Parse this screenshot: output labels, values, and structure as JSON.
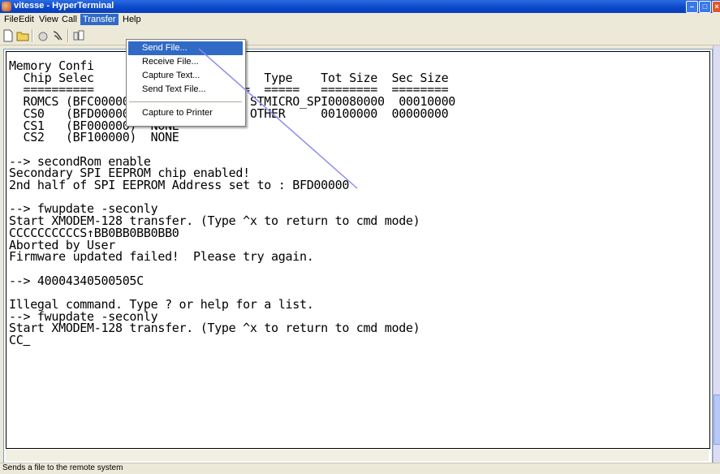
{
  "window": {
    "title": "vitesse - HyperTerminal"
  },
  "menubar": {
    "items": [
      {
        "label": "File"
      },
      {
        "label": "Edit"
      },
      {
        "label": "View"
      },
      {
        "label": "Call"
      },
      {
        "label": "Transfer"
      },
      {
        "label": "Help"
      }
    ]
  },
  "transfer_menu": {
    "items": [
      {
        "label": "Send File..."
      },
      {
        "label": "Receive File..."
      },
      {
        "label": "Capture Text..."
      },
      {
        "label": "Send Text File..."
      },
      {
        "label": "Capture to Printer"
      }
    ]
  },
  "terminal": {
    "lines": [
      "Memory Confi",
      "  Chip Selec                        Type    Tot Size  Sec Size",
      "  ==========                ======  =====   ========  ========",
      "  ROMCS (BFC00000)  SPI           STMICRO_SPI00080000  00010000",
      "  CS0   (BFD00000)  GENERIC_RAM   OTHER     00100000  00000000",
      "  CS1   (BF000000)  NONE",
      "  CS2   (BF100000)  NONE",
      "",
      "--> secondRom enable",
      "Secondary SPI EEPROM chip enabled!",
      "2nd half of SPI EEPROM Address set to : BFD00000",
      "",
      "--> fwupdate -seconly",
      "Start XMODEM-128 transfer. (Type ^x to return to cmd mode)",
      "CCCCCCCCCCS↑BB0BB0BB0BB0",
      "Aborted by User",
      "Firmware updated failed!  Please try again.",
      "",
      "--> 40004340500505C",
      "",
      "Illegal command. Type ? or help for a list.",
      "--> fwupdate -seconly",
      "Start XMODEM-128 transfer. (Type ^x to return to cmd mode)",
      "CC"
    ]
  },
  "status": {
    "text": "Sends a file to the remote system"
  },
  "colors": {
    "title_bar": "#0a47c9",
    "menu_highlight": "#316ac5",
    "annotation_line": "#8b8bf0"
  },
  "icons": [
    "new-connection-icon",
    "open-icon",
    "dial-icon",
    "disconnect-icon",
    "send-icon"
  ]
}
